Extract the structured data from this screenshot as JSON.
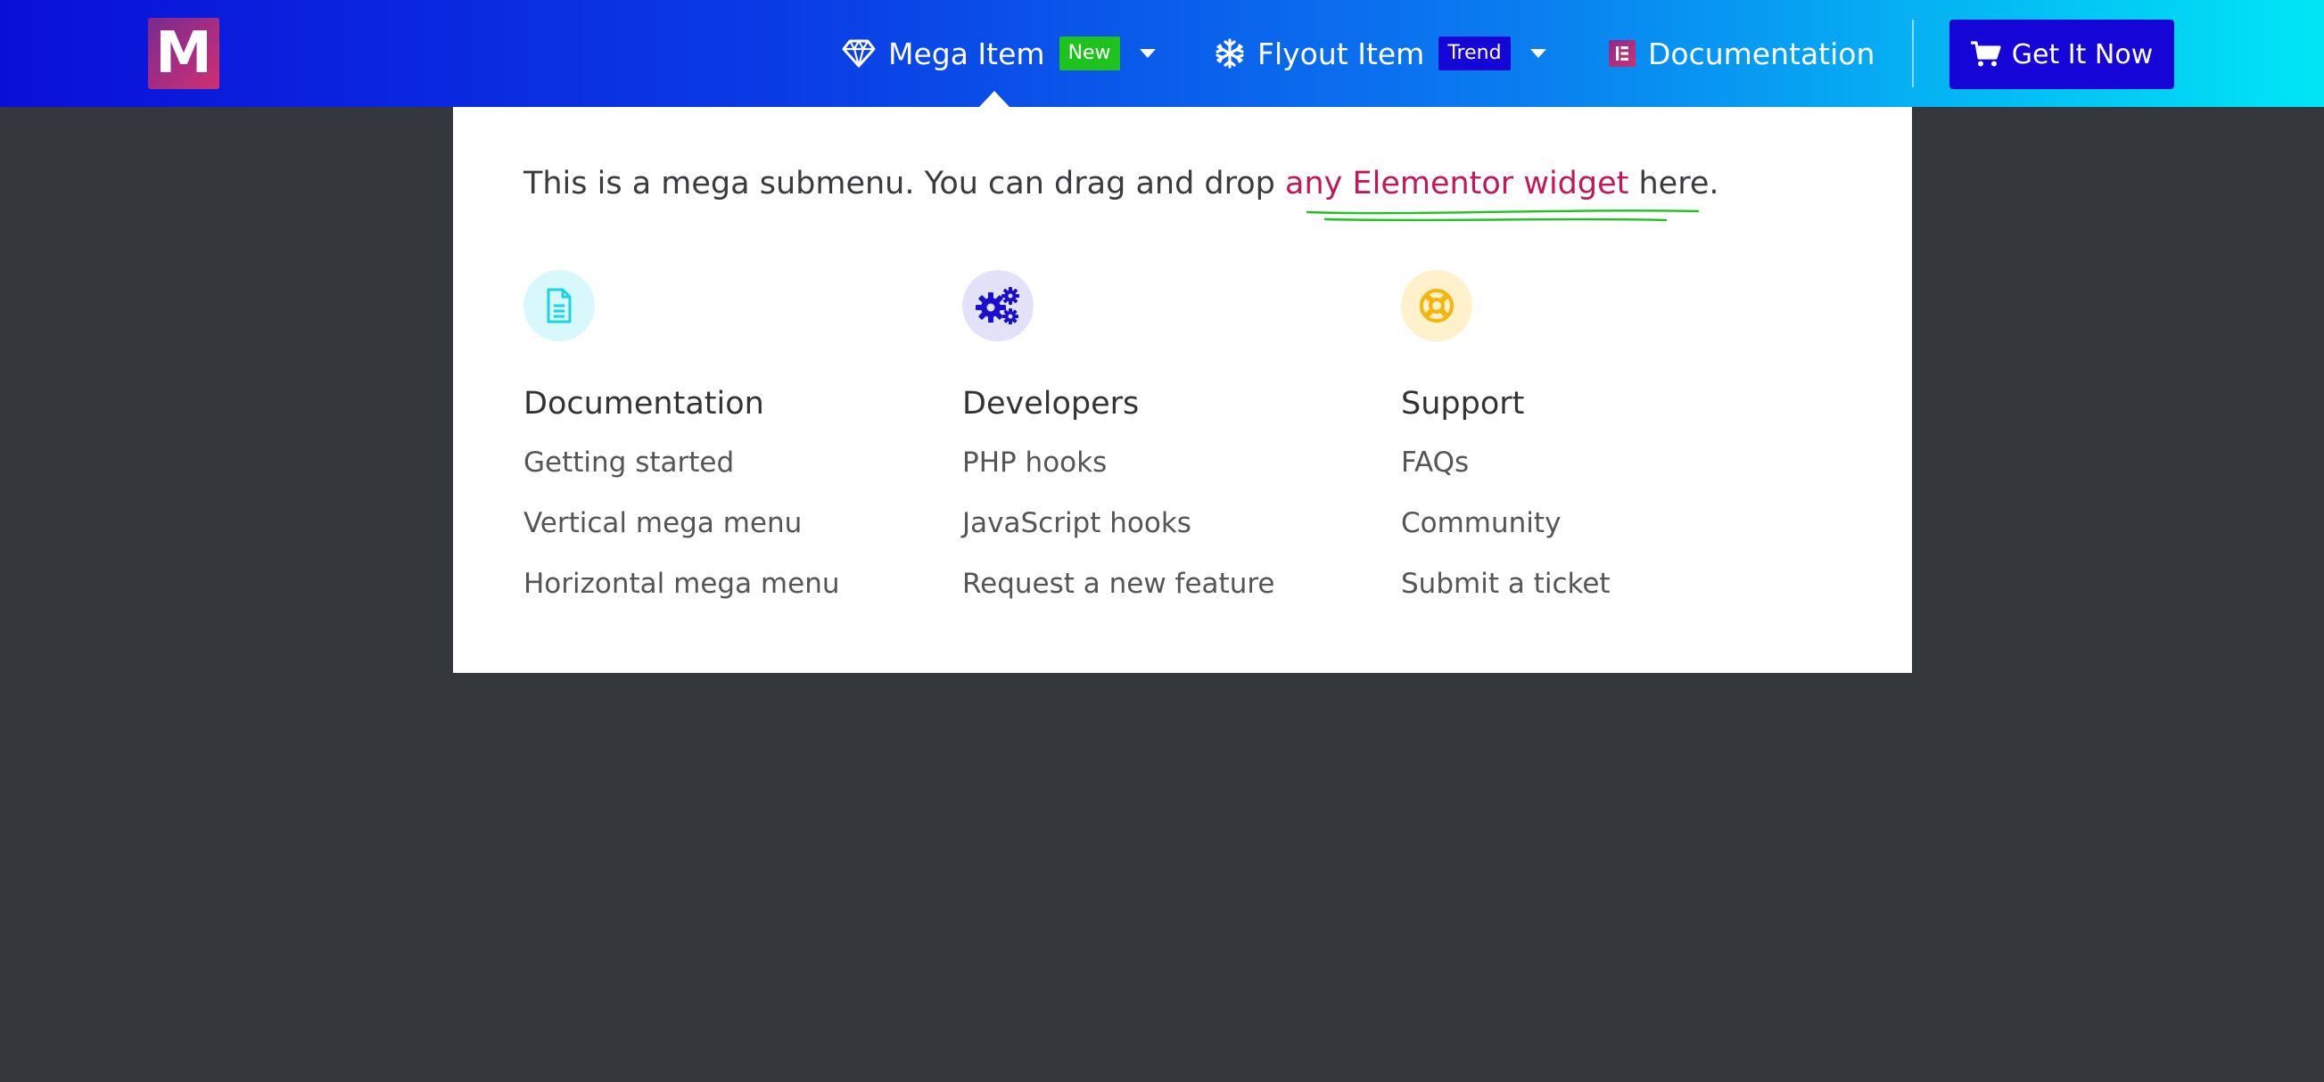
{
  "navbar": {
    "logo_text": "M",
    "items": [
      {
        "label": "Mega Item",
        "icon": "diamond-icon",
        "badge": "New",
        "badge_color": "#1ec31e",
        "has_dropdown": true
      },
      {
        "label": "Flyout Item",
        "icon": "snowflake-icon",
        "badge": "Trend",
        "badge_color": "#1505d6",
        "has_dropdown": true
      },
      {
        "label": "Documentation",
        "icon": "elementor-icon",
        "has_dropdown": false
      }
    ],
    "cta": {
      "label": "Get It Now",
      "icon": "cart-icon",
      "color": "#1505d6"
    }
  },
  "mega_menu": {
    "intro_before": "This is a mega submenu. You can drag and drop ",
    "intro_highlight": "any Elementor widget",
    "intro_after": " here.",
    "highlight_color": "#c2185b",
    "underline_color": "#1ec31e",
    "columns": [
      {
        "icon": "document-icon",
        "icon_bg": "#d9f8fb",
        "icon_color": "#17d5e6",
        "heading": "Documentation",
        "links": [
          "Getting started",
          "Vertical mega menu",
          "Horizontal mega menu"
        ]
      },
      {
        "icon": "gears-icon",
        "icon_bg": "#e3e2fb",
        "icon_color": "#1a0fd0",
        "heading": "Developers",
        "links": [
          "PHP hooks",
          "JavaScript hooks",
          "Request a new feature"
        ]
      },
      {
        "icon": "lifebuoy-icon",
        "icon_bg": "#fff1cc",
        "icon_color": "#f5b50a",
        "heading": "Support",
        "links": [
          "FAQs",
          "Community",
          "Submit a ticket"
        ]
      }
    ]
  }
}
